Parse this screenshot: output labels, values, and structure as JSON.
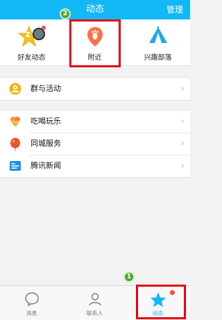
{
  "header": {
    "title": "动态",
    "right_action": "管理"
  },
  "top_items": [
    {
      "label": "好友动态",
      "icon": "star-badge-icon"
    },
    {
      "label": "附近",
      "icon": "footprint-pin-icon"
    },
    {
      "label": "兴趣部落",
      "icon": "tent-icon"
    }
  ],
  "friend_badge": "Z",
  "lists": {
    "group1": [
      {
        "label": "群与活动",
        "icon": "group-activity-icon"
      }
    ],
    "group2": [
      {
        "label": "吃喝玩乐",
        "icon": "ice-cream-icon"
      },
      {
        "label": "同城服务",
        "icon": "balloon-icon"
      },
      {
        "label": "腾讯新闻",
        "icon": "news-icon"
      }
    ]
  },
  "tabs": [
    {
      "label": "消息",
      "icon": "message-icon"
    },
    {
      "label": "联系人",
      "icon": "contacts-icon"
    },
    {
      "label": "动态",
      "icon": "star-icon"
    }
  ],
  "annotations": {
    "marker1": "1",
    "marker2": "2"
  },
  "colors": {
    "header": "#12b7f5",
    "highlight": "#e60012",
    "marker": "#4fa52a",
    "accent_orange": "#ff6f4a"
  }
}
